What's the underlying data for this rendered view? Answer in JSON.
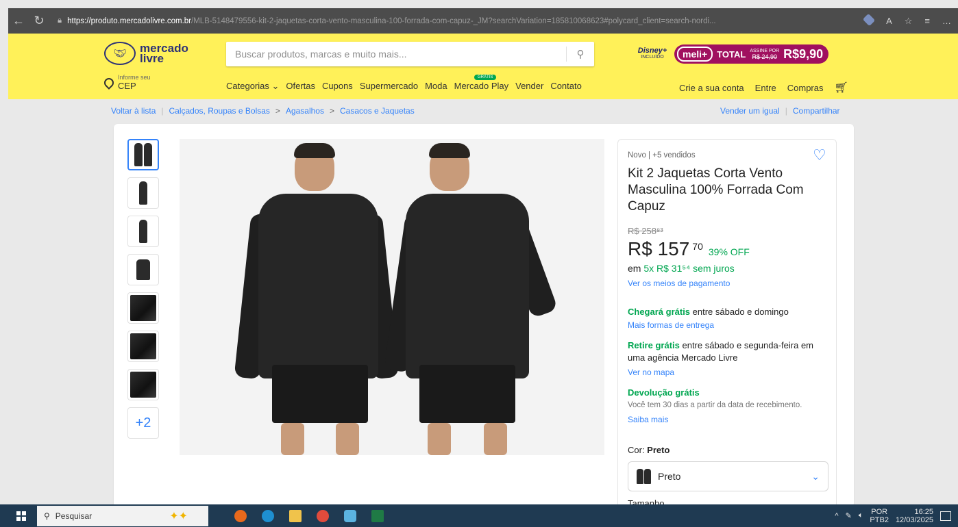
{
  "browser": {
    "url_host": "https://produto.mercadolivre.com.br",
    "url_path": "/MLB-5148479556-kit-2-jaquetas-corta-vento-masculina-100-forrada-com-capuz-_JM?searchVariation=185810068623#polycard_client=search-nordi..."
  },
  "header": {
    "logo_text_line1": "mercado",
    "logo_text_line2": "livre",
    "cep_label": "Informe seu",
    "cep_value": "CEP",
    "search_placeholder": "Buscar produtos, marcas e muito mais...",
    "disney_label": "Disney+",
    "disney_sub": "INCLUÍDO",
    "meli_label": "meli+",
    "meli_total": "TOTAL",
    "assine_label": "ASSINE POR",
    "assine_old": "R$ 24,90",
    "assine_price": "R$9,90",
    "nav": [
      "Categorias ⌄",
      "Ofertas",
      "Cupons",
      "Supermercado",
      "Moda",
      "Mercado Play",
      "Vender",
      "Contato"
    ],
    "mercado_play_badge": "GRÁTIS",
    "user_links": [
      "Crie a sua conta",
      "Entre",
      "Compras"
    ]
  },
  "breadcrumb": {
    "back": "Voltar à lista",
    "path": [
      "Calçados, Roupas e Bolsas",
      "Agasalhos",
      "Casacos e Jaquetas"
    ],
    "sell_same": "Vender um igual",
    "share": "Compartilhar"
  },
  "gallery": {
    "more_label": "+2"
  },
  "product": {
    "condition": "Novo | +5 vendidos",
    "title": "Kit 2 Jaquetas Corta Vento Masculina 100% Forrada Com Capuz",
    "old_price": "R$ 258⁸³",
    "price_main": "R$ 157",
    "price_cents": "70",
    "discount": "39% OFF",
    "installments_prefix": "em ",
    "installments_green": "5x R$ 31⁵⁴ sem juros",
    "payment_link": "Ver os meios de pagamento",
    "shipping_green": "Chegará grátis",
    "shipping_text": " entre sábado e domingo",
    "shipping_link": "Mais formas de entrega",
    "pickup_green": "Retire grátis",
    "pickup_text": " entre sábado e segunda-feira em uma agência Mercado Livre",
    "pickup_link": "Ver no mapa",
    "return_title": "Devolução grátis",
    "return_text": "Você tem 30 dias a partir da data de recebimento.",
    "return_link": "Saiba mais",
    "color_label": "Cor: ",
    "color_value": "Preto",
    "color_select": "Preto",
    "size_label_cut": "Tamanho"
  },
  "taskbar": {
    "search_label": "Pesquisar",
    "lang": "POR",
    "lang2": "PTB2",
    "time": "16:25",
    "date": "12/03/2025"
  },
  "colors": {
    "brand_yellow": "#fff159",
    "link_blue": "#3483fa",
    "green": "#00a650",
    "meli_magenta": "#a0105f"
  }
}
